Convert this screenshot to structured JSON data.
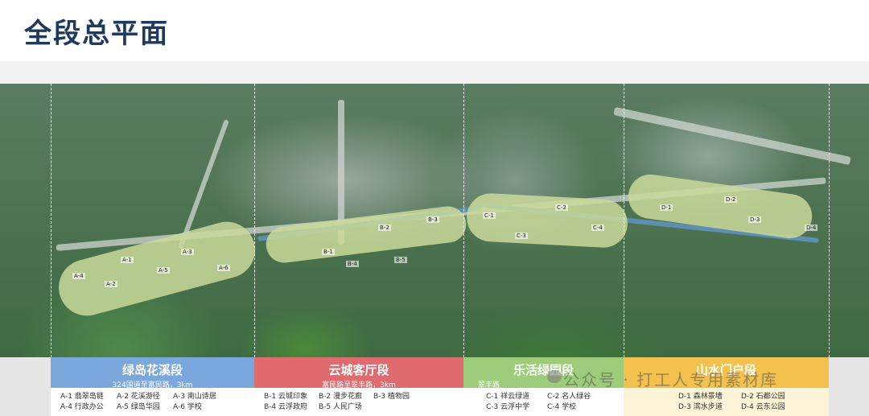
{
  "title": "全段总平面",
  "sections": [
    {
      "name": "绿岛花溪段",
      "sub": "324国道至富民路，3km",
      "color": "#7aa7dc",
      "items": [
        "A-1  翡翠岛链",
        "A-2  花溪游径",
        "A-3  南山诗居",
        "A-4  行政办公",
        "A-5  绿岛华园",
        "A-6  学校"
      ]
    },
    {
      "name": "云城客厅段",
      "sub": "富民路至翠丰路，3km",
      "color": "#e06b6e",
      "items": [
        "B-1  云城印象",
        "B-2  漫步花廊",
        "B-3  植物园",
        "B-4  云浮政府",
        "B-5  人民广场"
      ]
    },
    {
      "name": "乐活绿园段",
      "sub": "翠丰路",
      "color": "#9dcc7a",
      "items": [
        "C-1  祥云绿道",
        "C-2  名人绿谷",
        "C-3  云浮中学",
        "C-4  学校"
      ]
    },
    {
      "name": "山水门户段",
      "sub": "",
      "color": "#f2c14e",
      "items": [
        "D-1  森林景墙",
        "D-2  石都公园",
        "D-3  滨水步道",
        "D-4  云东公园"
      ]
    }
  ],
  "map_labels": [
    "A-1",
    "A-2",
    "A-3",
    "A-4",
    "A-5",
    "A-6",
    "B-1",
    "B-2",
    "B-3",
    "B-4",
    "B-5",
    "C-1",
    "C-2",
    "C-3",
    "C-4",
    "D-1",
    "D-2",
    "D-3",
    "D-4"
  ],
  "watermark": "公众号 · 打工人专用素材库"
}
